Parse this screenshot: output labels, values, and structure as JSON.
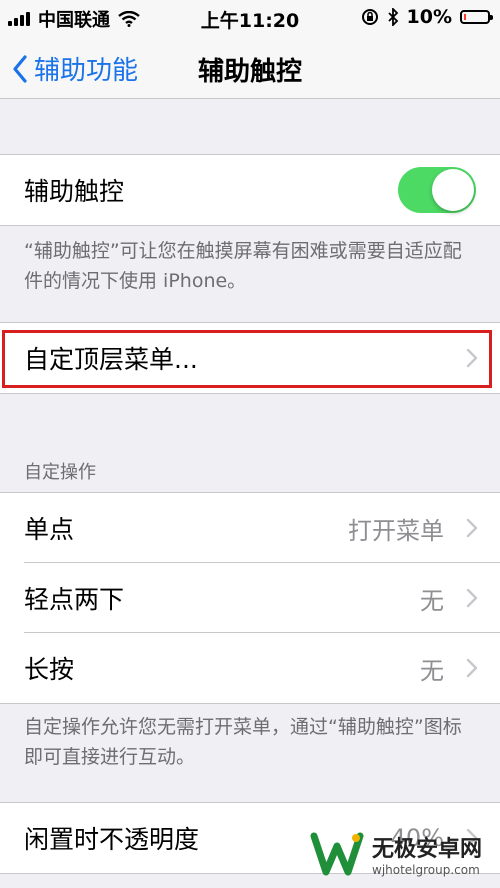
{
  "status_bar": {
    "carrier": "中国联通",
    "time": "上午11:20",
    "battery_percent": "10%",
    "battery_level": 0.1,
    "battery_color": "#ff3b30"
  },
  "nav": {
    "back_label": "辅助功能",
    "title": "辅助触控",
    "accent": "#1a73e8"
  },
  "assistive_touch": {
    "label": "辅助触控",
    "enabled": true,
    "toggle_color": "#4cd964",
    "description": "“辅助触控”可让您在触摸屏幕有困难或需要自适应配件的情况下使用 iPhone。"
  },
  "top_menu": {
    "label": "自定顶层菜单..."
  },
  "custom_actions": {
    "header": "自定操作",
    "items": [
      {
        "label": "单点",
        "value": "打开菜单"
      },
      {
        "label": "轻点两下",
        "value": "无"
      },
      {
        "label": "长按",
        "value": "无"
      }
    ],
    "footer": "自定操作允许您无需打开菜单，通过“辅助触控”图标即可直接进行互动。"
  },
  "opacity": {
    "label": "闲置时不透明度",
    "value": "40%"
  },
  "watermark": {
    "name": "无极安卓网",
    "url": "wjhotelgroup.com"
  }
}
